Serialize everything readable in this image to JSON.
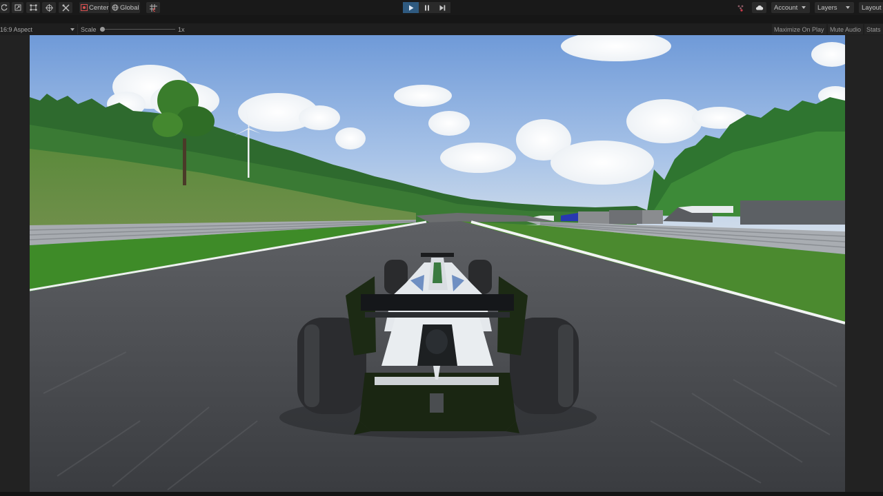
{
  "toolbar": {
    "left_tools": [
      {
        "name": "rotate-tool",
        "icon": "rotate-icon"
      },
      {
        "name": "rect-select-tool",
        "icon": "scale-icon"
      },
      {
        "name": "rect-tool",
        "icon": "rect-transform-icon"
      },
      {
        "name": "transform-tool",
        "icon": "transform-icon"
      },
      {
        "name": "custom-tool",
        "icon": "tools-icon"
      }
    ],
    "pivot_mode_label": "Center",
    "pivot_rotation_label": "Global",
    "grid_snap_icon": "grid-snap-icon",
    "play_controls": [
      {
        "name": "play-button",
        "icon": "play-icon",
        "active": true
      },
      {
        "name": "pause-button",
        "icon": "pause-icon",
        "active": false
      },
      {
        "name": "step-button",
        "icon": "step-icon",
        "active": false
      }
    ],
    "collab_icon": "collab-icon",
    "cloud_icon": "cloud-icon",
    "account_label": "Account",
    "layers_label": "Layers",
    "layout_label": "Layout"
  },
  "game_view": {
    "aspect_label": "16:9 Aspect",
    "scale_label": "Scale",
    "scale_value": "1x",
    "scale_fraction": 0.0,
    "maximize_on_play_label": "Maximize On Play",
    "mute_audio_label": "Mute Audio",
    "stats_label": "Stats"
  },
  "scene": {
    "description": "Formula race car on asphalt track viewed from behind, grass verges, trees, wind turbine, pit buildings",
    "colors": {
      "sky": "#7aa6de",
      "asphalt": "#4a4c50",
      "grass": "#3f8a2a",
      "trees": "#2f6d30",
      "car_body": "#e8ecef",
      "car_wing": "#1a2a14"
    }
  }
}
